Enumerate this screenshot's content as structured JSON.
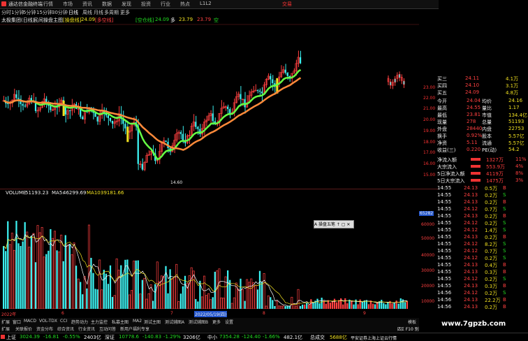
{
  "titlebar": {
    "app_name": "通达信金融终端",
    "menus": [
      "行情",
      "市场",
      "资讯",
      "数据",
      "发现",
      "投资",
      "行业",
      "热点",
      "L1L2"
    ],
    "trade_label": "交易"
  },
  "periods": [
    "分时",
    "1分钟",
    "5分钟",
    "15分钟",
    "30分钟",
    "日线",
    "周线",
    "月线",
    "多周期",
    "更多"
  ],
  "active_period": "日线",
  "infobar": {
    "stock": "太极集团(日线)",
    "indicator": "民间操盘主图",
    "line1_label": "[操盘线]",
    "line1_value": "24.09",
    "line2_label": "[多空线]",
    "line3_label": "[空仓线]",
    "line3_value": "24.09",
    "more_label": "多",
    "more_value": "23.79",
    "extra_value": "23.79",
    "extra_tag": "空"
  },
  "main_chart": {
    "price_high_label": "",
    "price_low_label": "14.60",
    "right_axis": [
      "23.00",
      "22.00",
      "21.00",
      "20.00",
      "19.00",
      "18.00",
      "17.00",
      "16.00",
      "15.00"
    ]
  },
  "vol_header": {
    "label": "VOLUME",
    "volume": "51193.23",
    "ma5_label": "MA5:",
    "ma5": "46299.69",
    "ma10_label": "MA10:",
    "ma10": "39181.66"
  },
  "vol_axis": [
    "60000",
    "50000",
    "40000",
    "30000",
    "20000",
    "10000"
  ],
  "vol_marker": "65282",
  "date_axis": {
    "start": "2022年",
    "highlight": "2022/05/19(四)",
    "marks": [
      "6",
      "7",
      "8",
      "9"
    ]
  },
  "tabs_row1": [
    "扩展",
    "窗口",
    "MACD",
    "VOL-TDX",
    "CCI",
    "趋势动力",
    "主力监控",
    "私募主图",
    "MA2",
    "测试主图",
    "测试辅图A",
    "测试辅图B",
    "更多",
    "设置"
  ],
  "tabs_row1_right": "模板",
  "tabs_row2": [
    "扩展",
    "关联报价",
    "资金分布",
    "综合资讯",
    "行业资讯",
    "互动问答",
    "新用户福利专享"
  ],
  "float_widget": "A 操盘五笔 ↑ ▢ ✕",
  "right_panel": {
    "order_book": [
      {
        "label": "买三",
        "price": "24.11",
        "vol": "4.1万"
      },
      {
        "label": "买四",
        "price": "24.10",
        "vol": "3.1万"
      },
      {
        "label": "买五",
        "price": "24.09",
        "vol": "4.8万"
      }
    ],
    "stats": [
      {
        "l1": "今开",
        "v1": "24.04",
        "l2": "均价",
        "v2": "24.16"
      },
      {
        "l1": "最高",
        "v1": "24.55",
        "l2": "量比",
        "v2": "1.17"
      },
      {
        "l1": "最低",
        "v1": "23.81",
        "l2": "市值",
        "v2": "134.4亿"
      },
      {
        "l1": "现量",
        "v1": "278",
        "l2": "总量",
        "v2": "51193"
      },
      {
        "l1": "外盘",
        "v1": "28440",
        "l2": "内盘",
        "v2": "22753"
      },
      {
        "l1": "换手",
        "v1": "0.92%",
        "l2": "股本",
        "v2": "5.57亿"
      },
      {
        "l1": "净资",
        "v1": "5.11",
        "l2": "流通",
        "v2": "5.57亿"
      },
      {
        "l1": "收益(三)",
        "v1": "0.220",
        "l2": "PE(动)",
        "v2": "54.2"
      }
    ],
    "flows": [
      {
        "label": "净流入额",
        "value": "1327万",
        "pct": "11%"
      },
      {
        "label": "大宗流入",
        "value": "553.9万",
        "pct": "4%"
      },
      {
        "label": "5日净流入额",
        "value": "4119万",
        "pct": "8%"
      },
      {
        "label": "5日大宗流入",
        "value": "1475万",
        "pct": "3%"
      }
    ],
    "ticks": [
      {
        "t": "14:55",
        "p": "24.13",
        "v": "0.5万",
        "s": "B"
      },
      {
        "t": "14:55",
        "p": "24.13",
        "v": "0.2万",
        "s": "S"
      },
      {
        "t": "14:55",
        "p": "24.13",
        "v": "0.2万",
        "s": "B"
      },
      {
        "t": "14:55",
        "p": "24.12",
        "v": "0.7万",
        "s": "S"
      },
      {
        "t": "14:55",
        "p": "24.13",
        "v": "0.2万",
        "s": "B"
      },
      {
        "t": "14:55",
        "p": "24.12",
        "v": "0.2万",
        "s": "S"
      },
      {
        "t": "14:55",
        "p": "24.12",
        "v": "1.4万",
        "s": "S"
      },
      {
        "t": "14:55",
        "p": "24.13",
        "v": "0.2万",
        "s": "B"
      },
      {
        "t": "14:55",
        "p": "24.12",
        "v": "8.2万",
        "s": "S"
      },
      {
        "t": "14:55",
        "p": "24.12",
        "v": "0.7万",
        "s": "S"
      },
      {
        "t": "14:55",
        "p": "24.12",
        "v": "0.2万",
        "s": "S"
      },
      {
        "t": "14:55",
        "p": "24.13",
        "v": "0.4万",
        "s": "B"
      },
      {
        "t": "14:55",
        "p": "24.13",
        "v": "0.3万",
        "s": "B"
      },
      {
        "t": "14:55",
        "p": "24.12",
        "v": "0.2万",
        "s": "S"
      },
      {
        "t": "14:55",
        "p": "24.13",
        "v": "0.3万",
        "s": "B"
      },
      {
        "t": "14:56",
        "p": "24.12",
        "v": "0.2万",
        "s": "S"
      },
      {
        "t": "14:56",
        "p": "24.13",
        "v": "22.2万",
        "s": "B"
      },
      {
        "t": "14:56",
        "p": "24.13",
        "v": "0.2万",
        "s": "B"
      }
    ]
  },
  "index_bar": [
    {
      "name": "上证",
      "value": "3024.39",
      "chg": "-16.81",
      "pct": "-0.55%",
      "amt": "2403亿"
    },
    {
      "name": "深证",
      "value": "10778.6",
      "chg": "-140.83",
      "pct": "-1.29%",
      "amt": "3206亿"
    },
    {
      "name": "中小",
      "value": "7354.28",
      "chg": "-124.40",
      "pct": "-1.66%",
      "amt": "482.1亿"
    },
    {
      "name": "总成交",
      "value": "5688亿",
      "chg": "",
      "pct": "",
      "amt": ""
    }
  ],
  "marquee": "平安证券上海上证云行情",
  "status_right": "四Σ F10 别",
  "watermark": "www.7gpzb.com",
  "colors": {
    "up": "#ff4040",
    "down": "#22dd22",
    "bg": "#000000",
    "accent": "#f0e020"
  }
}
